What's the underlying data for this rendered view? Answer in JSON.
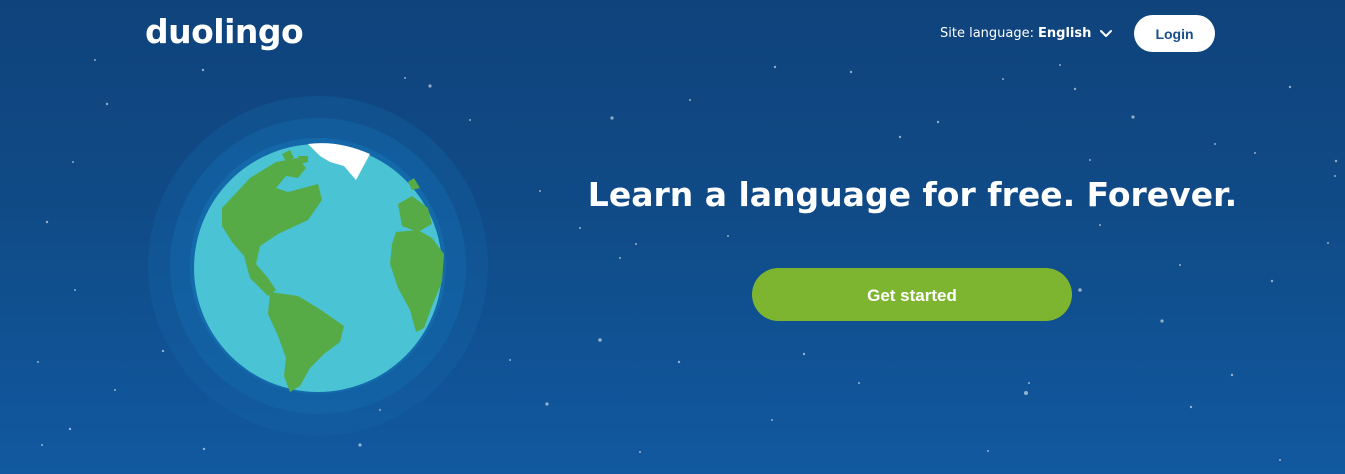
{
  "header": {
    "logo_text": "duolingo",
    "site_language_label": "Site language:",
    "site_language_value": "English",
    "login_label": "Login"
  },
  "hero": {
    "headline": "Learn a language for free. Forever.",
    "cta_label": "Get started",
    "illustration": "globe"
  },
  "colors": {
    "background_top": "#0f437c",
    "background_bottom": "#1159a0",
    "cta_green": "#7eb530",
    "ocean": "#4ac3d4",
    "land": "#57ab47",
    "login_text": "#1a4f8b"
  }
}
